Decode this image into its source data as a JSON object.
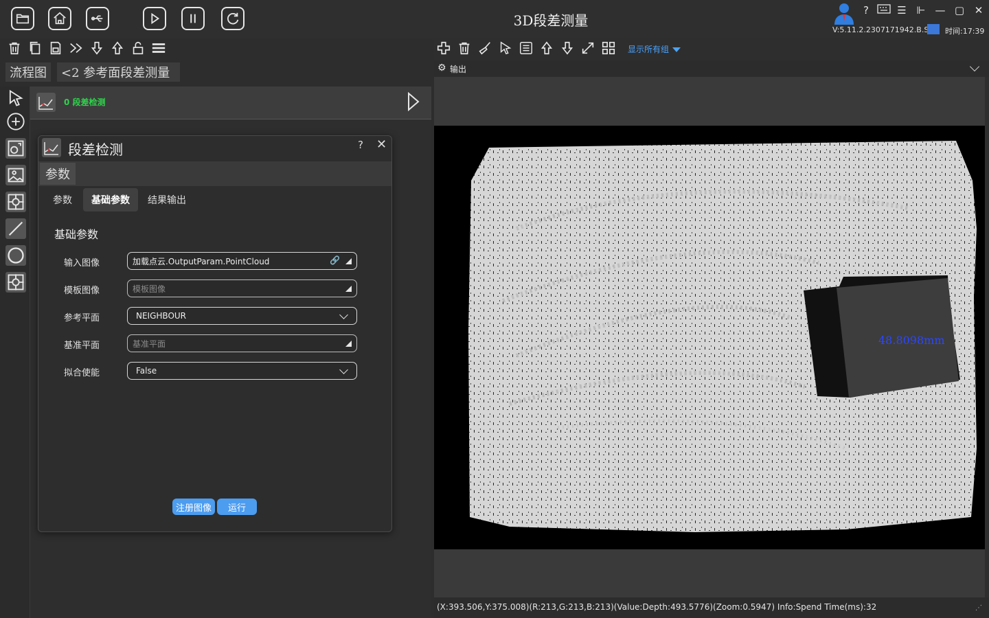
{
  "app": {
    "title": "3D段差测量",
    "version": "V:5.11.2.2307171942.B.S.C",
    "clock": "时间:17:39"
  },
  "breadcrumb": {
    "flow": "流程图",
    "current": "<2  参考面段差测量"
  },
  "flow_node": {
    "label": "0  段差检测"
  },
  "dialog": {
    "title": "段差检测",
    "help": "?",
    "close": "✕",
    "section_tab": "参数",
    "subtabs": [
      "参数",
      "基础参数",
      "结果输出"
    ],
    "group_title": "基础参数",
    "params": [
      {
        "label": "输入图像",
        "value": "加载点云.OutputParam.PointCloud"
      },
      {
        "label": "模板图像",
        "placeholder": "模板图像"
      },
      {
        "label": "参考平面",
        "value": "NEIGHBOUR"
      },
      {
        "label": "基准平面",
        "placeholder": "基准平面"
      },
      {
        "label": "拟合使能",
        "value": "False"
      }
    ],
    "buttons": {
      "register": "注册图像",
      "run": "运行"
    }
  },
  "output": {
    "show_all": "显示所有组",
    "panel_label": "输出",
    "measurement": "48.8098mm",
    "status": "(X:393.506,Y:375.008)(R:213,G:213,B:213)(Value:Depth:493.5776)(Zoom:0.5947)   Info:Spend Time(ms):32"
  },
  "colors": {
    "accent": "#4c9cf0",
    "node_label": "#2fd34b",
    "measure": "#2c47ff"
  }
}
